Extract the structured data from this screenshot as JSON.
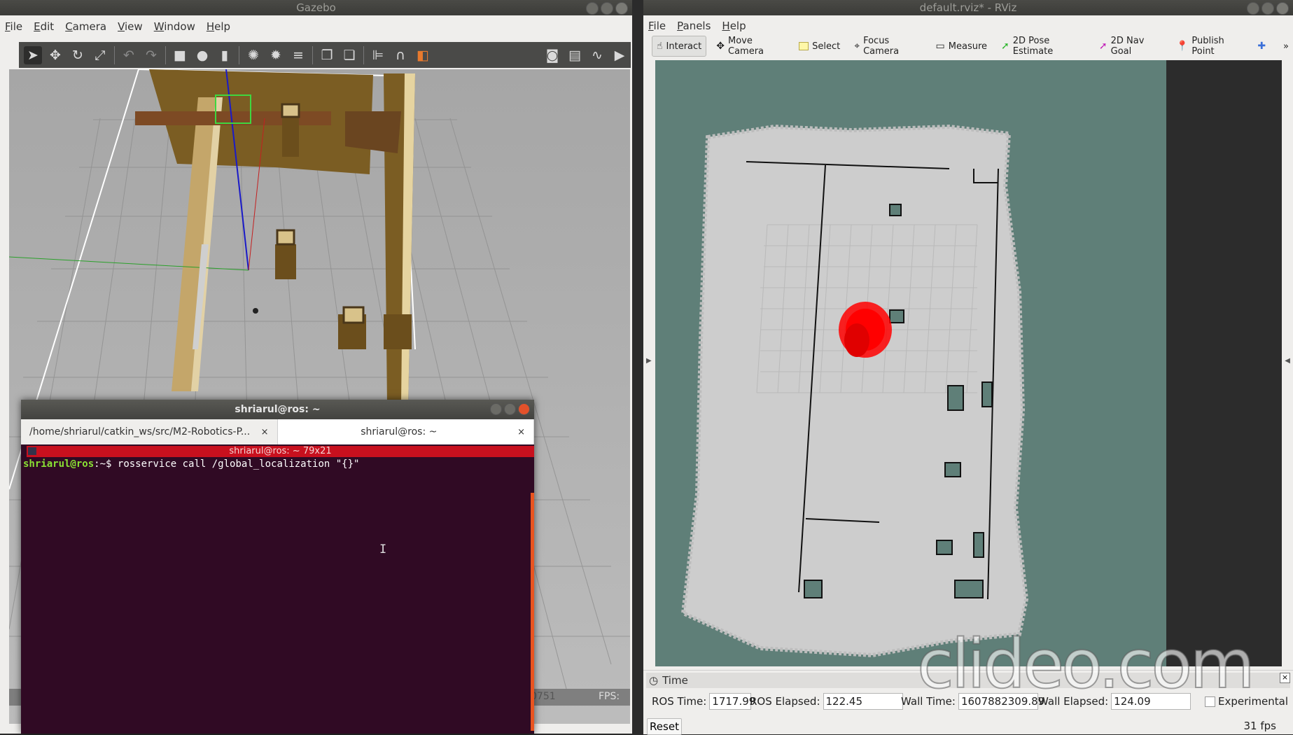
{
  "gazebo": {
    "title": "Gazebo",
    "menu": [
      "File",
      "Edit",
      "Camera",
      "View",
      "Window",
      "Help"
    ],
    "toolbar_icons": [
      "select-arrow-icon",
      "translate-icon",
      "rotate-icon",
      "scale-icon",
      "undo-icon",
      "redo-icon",
      "box-icon",
      "sphere-icon",
      "cylinder-icon",
      "point-light-icon",
      "spot-light-icon",
      "directional-light-icon",
      "copy-icon",
      "paste-icon",
      "align-icon",
      "snap-icon",
      "color-icon",
      "screenshot-icon",
      "log-icon",
      "plot-icon",
      "video-icon"
    ],
    "status_partial": "0751",
    "fps_label": "FPS:"
  },
  "terminal": {
    "window_title": "shriarul@ros: ~",
    "tabs": [
      {
        "label": "/home/shriarul/catkin_ws/src/M2-Robotics-P...",
        "close": "×"
      },
      {
        "label": "shriarul@ros: ~",
        "close": "×"
      }
    ],
    "inner_title": "shriarul@ros: ~ 79x21",
    "prompt_user": "shriarul@ros",
    "prompt_path": ":~",
    "prompt_symbol": "$",
    "command": "rosservice call /global_localization \"{}\""
  },
  "rviz": {
    "title": "default.rviz* - RViz",
    "menu": [
      "File",
      "Panels",
      "Help"
    ],
    "tools": [
      {
        "label": "Interact",
        "icon": "hand-icon",
        "active": true
      },
      {
        "label": "Move Camera",
        "icon": "move-camera-icon",
        "active": false
      },
      {
        "label": "Select",
        "icon": "select-box-icon",
        "active": false
      },
      {
        "label": "Focus Camera",
        "icon": "focus-camera-icon",
        "active": false
      },
      {
        "label": "Measure",
        "icon": "ruler-icon",
        "active": false
      },
      {
        "label": "2D Pose Estimate",
        "icon": "green-arrow-icon",
        "active": false
      },
      {
        "label": "2D Nav Goal",
        "icon": "magenta-arrow-icon",
        "active": false
      },
      {
        "label": "Publish Point",
        "icon": "map-pin-icon",
        "active": false
      }
    ],
    "time_panel": {
      "header": "Time",
      "ros_time_label": "ROS Time:",
      "ros_time": "1717.99",
      "ros_elapsed_label": "ROS Elapsed:",
      "ros_elapsed": "122.45",
      "wall_time_label": "Wall Time:",
      "wall_time": "1607882309.89",
      "wall_elapsed_label": "Wall Elapsed:",
      "wall_elapsed": "124.09",
      "experimental_label": "Experimental",
      "reset_label": "Reset",
      "fps": "31 fps"
    },
    "colors": {
      "background": "#5f7f78",
      "map_free": "#d3d3d3",
      "particles": "#ff0000"
    }
  },
  "watermark": "clideo.com"
}
